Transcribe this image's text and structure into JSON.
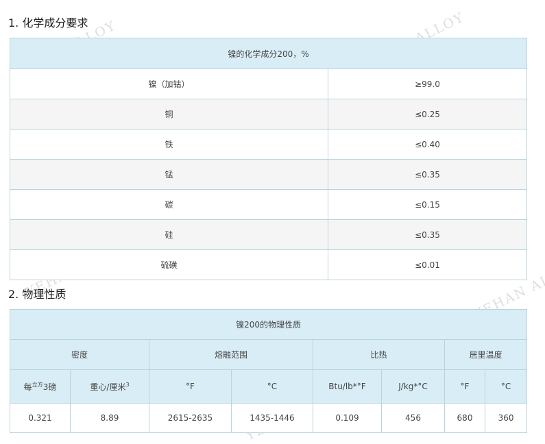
{
  "section1": {
    "title": "1. 化学成分要求",
    "caption": "镍的化学成分200，%",
    "rows": [
      {
        "element": "镍（加钴）",
        "value": "≥99.0"
      },
      {
        "element": "铜",
        "value": "≤0.25"
      },
      {
        "element": "铁",
        "value": "≤0.40"
      },
      {
        "element": "锰",
        "value": "≤0.35"
      },
      {
        "element": "碳",
        "value": "≤0.15"
      },
      {
        "element": "硅",
        "value": "≤0.35"
      },
      {
        "element": "硫磺",
        "value": "≤0.01"
      }
    ]
  },
  "section2": {
    "title": "2. 物理性质",
    "caption": "镍200的物理性质",
    "groups": {
      "density": "密度",
      "melting": "熔融范围",
      "specific_heat": "比热",
      "curie": "居里温度"
    },
    "units": {
      "density_imperial_base": "每",
      "density_imperial_sup": "立方",
      "density_imperial_tail": "3磅",
      "density_metric_base": "重心/厘米",
      "density_metric_sup": "3",
      "melt_f": "°F",
      "melt_c": "°C",
      "heat_imperial": "Btu/lb*°F",
      "heat_metric": "J/kg*°C",
      "curie_f": "°F",
      "curie_c": "°C"
    },
    "values": {
      "density_imperial": "0.321",
      "density_metric": "8.89",
      "melt_f": "2615-2635",
      "melt_c": "1435-1446",
      "heat_imperial": "0.109",
      "heat_metric": "456",
      "curie_f": "680",
      "curie_c": "360"
    }
  },
  "watermark": "YEHAN ALLOY"
}
